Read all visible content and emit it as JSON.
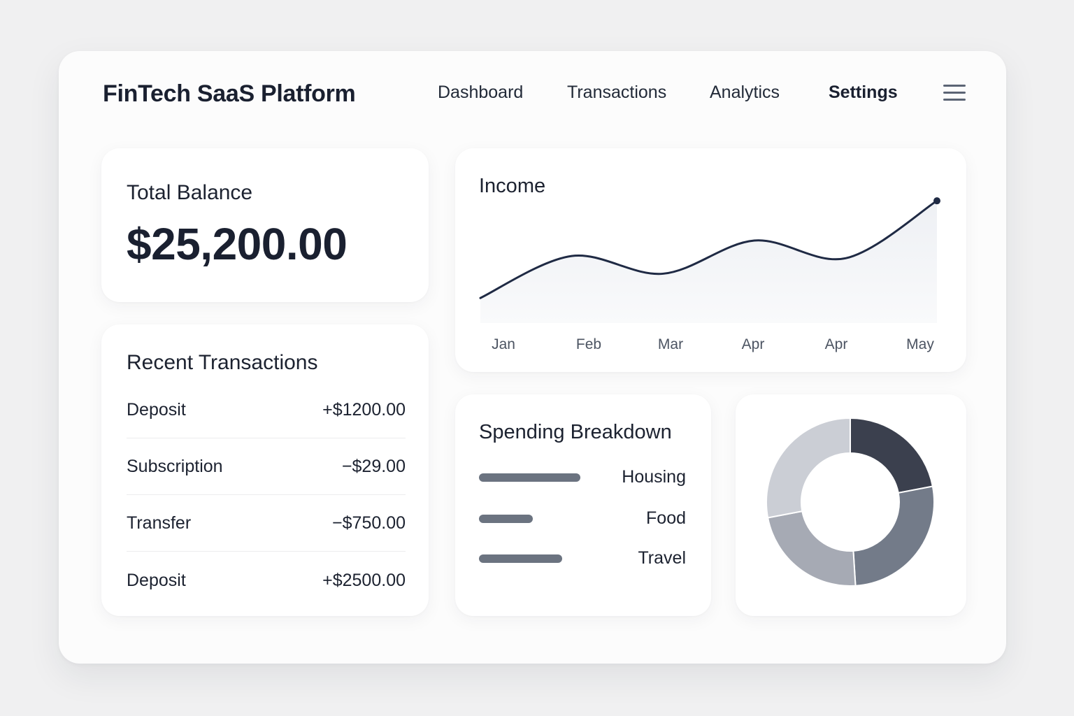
{
  "app": {
    "title": "FinTech SaaS Platform"
  },
  "nav": {
    "items": [
      {
        "label": "Dashboard"
      },
      {
        "label": "Transactions"
      },
      {
        "label": "Analytics"
      },
      {
        "label": "Settings",
        "active": true
      }
    ],
    "menu_icon": "hamburger-menu-icon"
  },
  "balance": {
    "title": "Total Balance",
    "value": "$25,200.00"
  },
  "transactions": {
    "title": "Recent Transactions",
    "rows": [
      {
        "name": "Deposit",
        "amount": "+$1200.00"
      },
      {
        "name": "Subscription",
        "amount": "−$29.00"
      },
      {
        "name": "Transfer",
        "amount": "−$750.00"
      },
      {
        "name": "Deposit",
        "amount": "+$2500.00"
      }
    ]
  },
  "income": {
    "title": "Income"
  },
  "spending": {
    "title": "Spending Breakdown"
  },
  "colors": {
    "line": "#1f2a44",
    "area": "#eef0f4",
    "bar": "#6b7380",
    "donut": [
      "#3b404e",
      "#737b89",
      "#a6aab4",
      "#cbced5"
    ]
  },
  "chart_data": [
    {
      "type": "line",
      "title": "Income",
      "x": [
        "Jan",
        "Feb",
        "Mar",
        "Apr",
        "Apr",
        "May"
      ],
      "y": [
        10,
        48,
        32,
        62,
        46,
        98
      ],
      "ylim": [
        0,
        100
      ],
      "grid": false,
      "legend": "none"
    },
    {
      "type": "bar",
      "orientation": "horizontal",
      "title": "Spending Breakdown",
      "categories": [
        "Housing",
        "Food",
        "Travel"
      ],
      "values": [
        100,
        53,
        82
      ]
    },
    {
      "type": "pie",
      "style": "donut",
      "values": [
        22,
        27,
        23,
        28
      ]
    }
  ]
}
